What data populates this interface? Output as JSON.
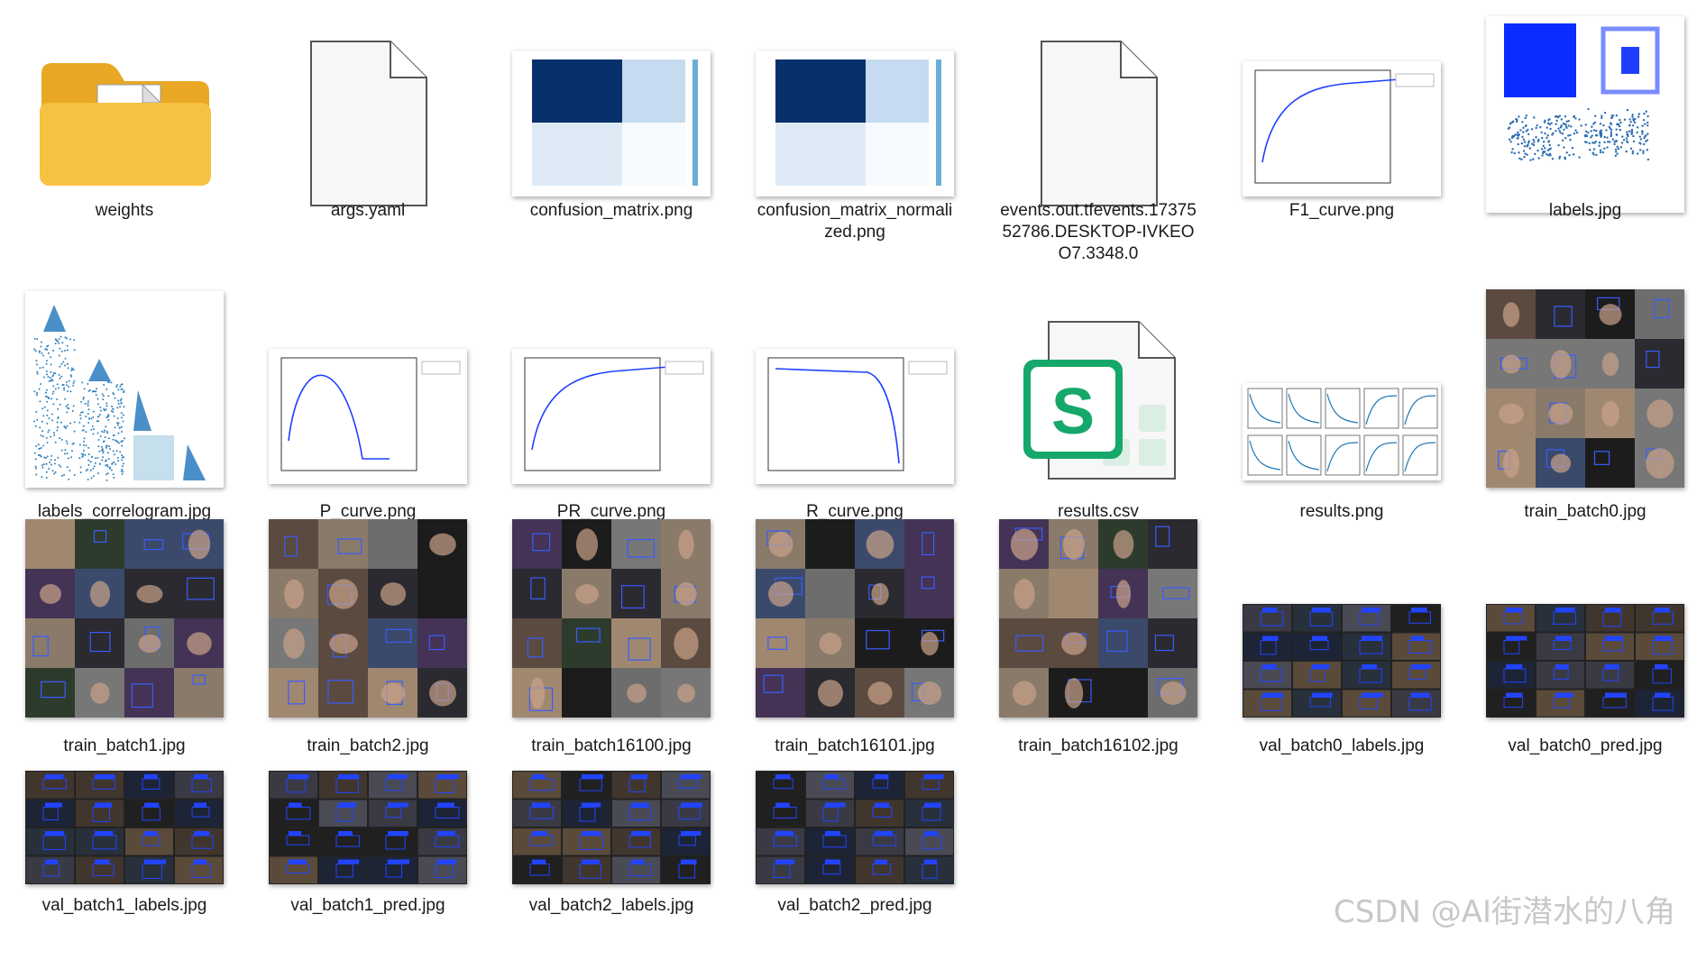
{
  "files": [
    {
      "name": "weights",
      "kind": "folder",
      "icon": "folder-icon"
    },
    {
      "name": "args.yaml",
      "kind": "file",
      "icon": "blank-file-icon"
    },
    {
      "name": "confusion_matrix.png",
      "kind": "cm"
    },
    {
      "name": "confusion_matrix_normalized.png",
      "kind": "cm"
    },
    {
      "name": "events.out.tfevents.1737552786.DESKTOP-IVKEOO7.3348.0",
      "kind": "file",
      "icon": "blank-file-icon"
    },
    {
      "name": "F1_curve.png",
      "kind": "curve"
    },
    {
      "name": "labels.jpg",
      "kind": "labels"
    },
    {
      "name": "labels_correlogram.jpg",
      "kind": "correlogram"
    },
    {
      "name": "P_curve.png",
      "kind": "curve"
    },
    {
      "name": "PR_curve.png",
      "kind": "curve"
    },
    {
      "name": "R_curve.png",
      "kind": "curve"
    },
    {
      "name": "results.csv",
      "kind": "csv",
      "icon": "spreadsheet-icon"
    },
    {
      "name": "results.png",
      "kind": "results"
    },
    {
      "name": "train_batch0.jpg",
      "kind": "mosaic"
    },
    {
      "name": "train_batch1.jpg",
      "kind": "mosaic"
    },
    {
      "name": "train_batch2.jpg",
      "kind": "mosaic"
    },
    {
      "name": "train_batch16100.jpg",
      "kind": "mosaic"
    },
    {
      "name": "train_batch16101.jpg",
      "kind": "mosaic"
    },
    {
      "name": "train_batch16102.jpg",
      "kind": "mosaic"
    },
    {
      "name": "val_batch0_labels.jpg",
      "kind": "valgrid"
    },
    {
      "name": "val_batch0_pred.jpg",
      "kind": "valgrid"
    },
    {
      "name": "val_batch1_labels.jpg",
      "kind": "valgrid"
    },
    {
      "name": "val_batch1_pred.jpg",
      "kind": "valgrid"
    },
    {
      "name": "val_batch2_labels.jpg",
      "kind": "valgrid"
    },
    {
      "name": "val_batch2_pred.jpg",
      "kind": "valgrid"
    }
  ],
  "csv_icon_letter": "S",
  "watermark": "CSDN @AI街潜水的八角",
  "colors": {
    "folder": "#f5c242",
    "csv_green": "#16a86a",
    "plot_blue": "#1f3fff",
    "cm_dark": "#08306b"
  }
}
